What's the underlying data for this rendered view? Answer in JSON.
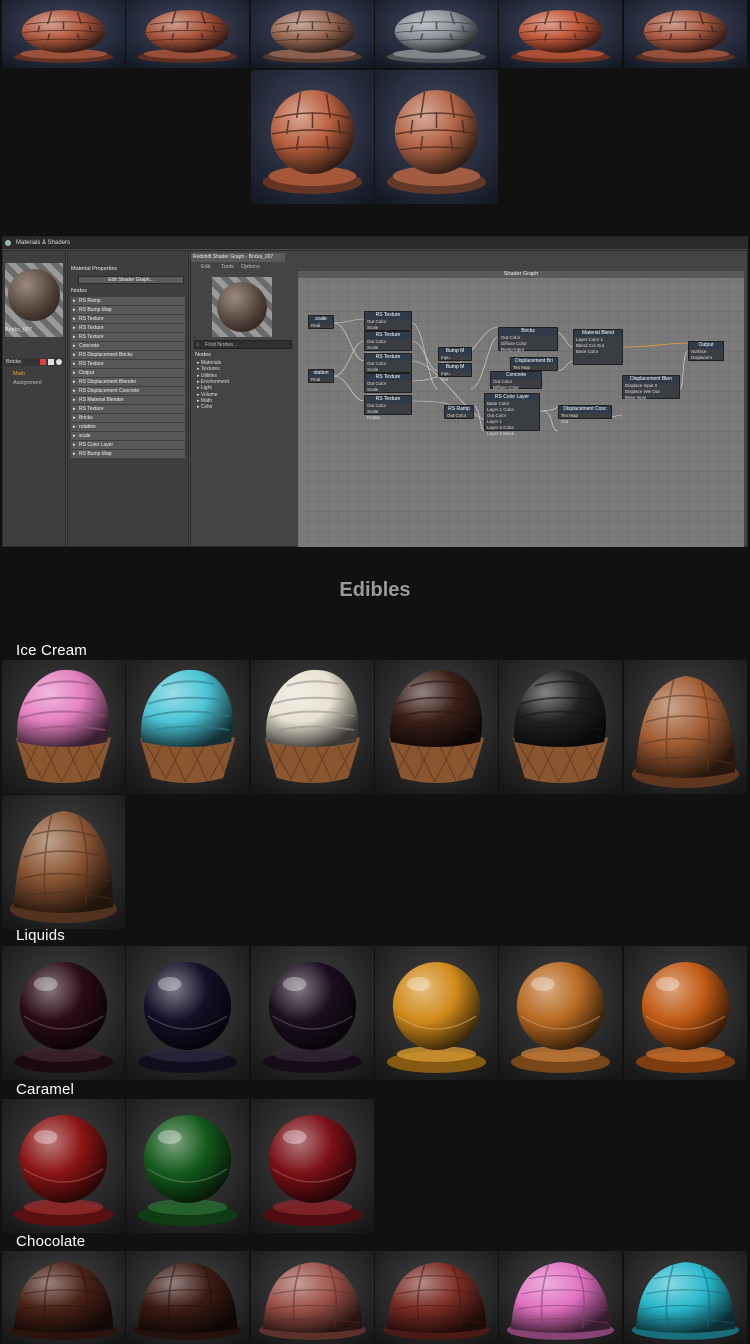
{
  "colors": {
    "page_bg": "#111111",
    "tile_bg_blue": "#28304a",
    "tile_bg_dark": "#2b2b2b",
    "heading_gray": "#9a9a9a",
    "accent_orange": "#f0a030"
  },
  "editor": {
    "window_title": "Materials & Shaders",
    "material_name": "Bricks_007",
    "layer_name": "Bricks",
    "tab_main": "Main",
    "tab_assignment": "Assignment",
    "material_properties": "Material Properties",
    "edit_shader_graph": "Edit Shader Graph...",
    "nodes_header": "Nodes",
    "node_list": [
      "RS Ramp",
      "RS Bump Map",
      "RS Texture",
      "RS Texture",
      "RS Texture",
      "Concrete",
      "RS Displacement Bricks",
      "RS Texture",
      "Output",
      "RS Displacement Blender",
      "RS Displacement Concrete",
      "RS Material Blender",
      "RS Texture",
      "Bricks",
      "rotation",
      "scale",
      "RS Color Layer",
      "RS Bump Map"
    ],
    "graph_tab": "Redshift Shader Graph - Bricks_007",
    "menu": [
      "Edit",
      "Tools",
      "Options"
    ],
    "find_placeholder": "Find Nodes...",
    "tree_header": "Nodes",
    "tree_items": [
      "Materials",
      "Textures",
      "Utilities",
      "Environment",
      "Light",
      "Volume",
      "Math",
      "Color"
    ],
    "graph_title": "Shader Graph",
    "graph_nodes": {
      "scale": "scale",
      "rotation": "otation",
      "real": "Real",
      "rs_texture": "RS Texture",
      "scale_port": "Scale",
      "rotate_port": "Rotate",
      "out_color": "Out Color",
      "bump_map": "Bump M",
      "input": "Inpu",
      "out": "Out",
      "bricks": "Bricks",
      "diffuse_color": "Diffuse Color",
      "bump_input": "Bump Input",
      "displacement_bricks": "Displacement Bri",
      "tex_map": "Tex Map",
      "concrete": "Concrete",
      "rs_ramp": "RS Ramp",
      "rs_color_layer": "RS Color Layer",
      "base_color": "Base Color",
      "layer_1_color": "Layer 1 Color",
      "layer_1_mask": "Layer 1",
      "layer_2_color": "Layer 2 Color",
      "layer_2_mask": "Layer 2 Mask",
      "material_blender": "Material Blend",
      "layer_color_1": "Layer Color 1",
      "blend_col_out": "Blend Col Out",
      "displacement_blender": "Displacement Blen",
      "displace_input_0": "Displace Input 0",
      "displace_wei": "Displace Wei Out",
      "base_input": "Base Input",
      "displacement_concrete": "Displacement Conc",
      "output": "Output",
      "surface": "Surface",
      "displacement": "Displacem"
    }
  },
  "heading": "Edibles",
  "sections": {
    "ice_cream": "Ice Cream",
    "liquids": "Liquids",
    "caramel": "Caramel",
    "chocolate": "Chocolate"
  },
  "tiles": {
    "top_bricks": [
      {
        "style": "brick",
        "color": "#b05a40"
      },
      {
        "style": "brick",
        "color": "#a8553d"
      },
      {
        "style": "brick",
        "color": "#9a6a55"
      },
      {
        "style": "brick",
        "color": "#8e949c"
      },
      {
        "style": "brick",
        "color": "#c0583a"
      },
      {
        "style": "brick",
        "color": "#a85a42"
      }
    ],
    "feature_bricks": [
      {
        "style": "brick",
        "color": "#b8603f"
      },
      {
        "style": "brick",
        "color": "#b36648"
      }
    ],
    "ice_cream": [
      {
        "style": "scoop",
        "color": "#e480c0"
      },
      {
        "style": "scoop",
        "color": "#4cc4d6"
      },
      {
        "style": "scoop",
        "color": "#e8e2d2"
      },
      {
        "style": "scoop",
        "color": "#3a2018"
      },
      {
        "style": "scoop",
        "color": "#222222"
      },
      {
        "style": "drape",
        "color": "#a05c32"
      },
      {
        "style": "drape",
        "color": "#8a5534"
      }
    ],
    "liquids": [
      {
        "style": "glass",
        "color": "#2a0c14"
      },
      {
        "style": "glass",
        "color": "#141028"
      },
      {
        "style": "glass",
        "color": "#1c0e20"
      },
      {
        "style": "glass",
        "color": "#d08a1a"
      },
      {
        "style": "glass",
        "color": "#b86a22"
      },
      {
        "style": "glass",
        "color": "#c05a14"
      }
    ],
    "caramel": [
      {
        "style": "glass",
        "color": "#8a1414"
      },
      {
        "style": "glass",
        "color": "#145a1c"
      },
      {
        "style": "glass",
        "color": "#7a1016"
      }
    ],
    "chocolate": [
      {
        "style": "drape",
        "color": "#4a2216"
      },
      {
        "style": "drape",
        "color": "#3c1c14"
      },
      {
        "style": "drape",
        "color": "#9a5048"
      },
      {
        "style": "drape",
        "color": "#7a2c24"
      },
      {
        "style": "drape",
        "color": "#e070c0"
      },
      {
        "style": "drape",
        "color": "#28b8cc"
      }
    ]
  }
}
